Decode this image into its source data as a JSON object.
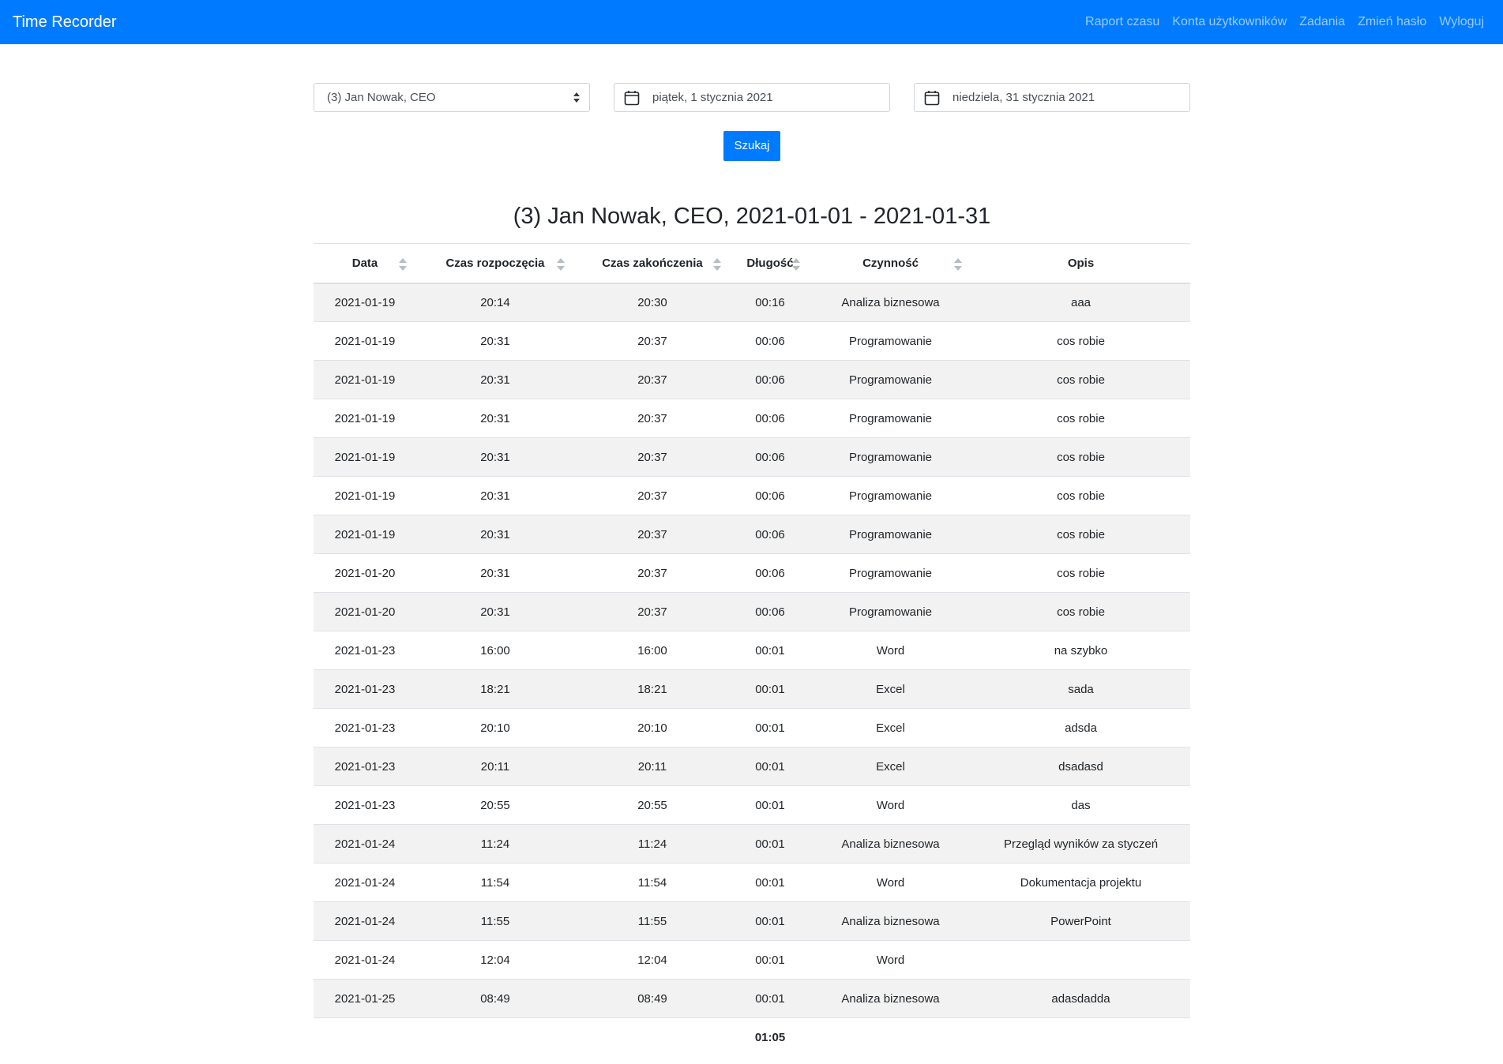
{
  "navbar": {
    "brand": "Time Recorder",
    "links": [
      "Raport czasu",
      "Konta użytkowników",
      "Zadania",
      "Zmień hasło",
      "Wyloguj"
    ]
  },
  "filters": {
    "user": "(3) Jan Nowak, CEO",
    "date_from": "piątek, 1 stycznia 2021",
    "date_to": "niedziela, 31 stycznia 2021",
    "search_label": "Szukaj"
  },
  "report": {
    "title": "(3) Jan Nowak, CEO, 2021-01-01 - 2021-01-31",
    "columns": [
      "Data",
      "Czas rozpoczęcia",
      "Czas zakończenia",
      "Długość",
      "Czynność",
      "Opis"
    ],
    "rows": [
      [
        "2021-01-19",
        "20:14",
        "20:30",
        "00:16",
        "Analiza biznesowa",
        "aaa"
      ],
      [
        "2021-01-19",
        "20:31",
        "20:37",
        "00:06",
        "Programowanie",
        "cos robie"
      ],
      [
        "2021-01-19",
        "20:31",
        "20:37",
        "00:06",
        "Programowanie",
        "cos robie"
      ],
      [
        "2021-01-19",
        "20:31",
        "20:37",
        "00:06",
        "Programowanie",
        "cos robie"
      ],
      [
        "2021-01-19",
        "20:31",
        "20:37",
        "00:06",
        "Programowanie",
        "cos robie"
      ],
      [
        "2021-01-19",
        "20:31",
        "20:37",
        "00:06",
        "Programowanie",
        "cos robie"
      ],
      [
        "2021-01-19",
        "20:31",
        "20:37",
        "00:06",
        "Programowanie",
        "cos robie"
      ],
      [
        "2021-01-20",
        "20:31",
        "20:37",
        "00:06",
        "Programowanie",
        "cos robie"
      ],
      [
        "2021-01-20",
        "20:31",
        "20:37",
        "00:06",
        "Programowanie",
        "cos robie"
      ],
      [
        "2021-01-23",
        "16:00",
        "16:00",
        "00:01",
        "Word",
        "na szybko"
      ],
      [
        "2021-01-23",
        "18:21",
        "18:21",
        "00:01",
        "Excel",
        "sada"
      ],
      [
        "2021-01-23",
        "20:10",
        "20:10",
        "00:01",
        "Excel",
        "adsda"
      ],
      [
        "2021-01-23",
        "20:11",
        "20:11",
        "00:01",
        "Excel",
        "dsadasd"
      ],
      [
        "2021-01-23",
        "20:55",
        "20:55",
        "00:01",
        "Word",
        "das"
      ],
      [
        "2021-01-24",
        "11:24",
        "11:24",
        "00:01",
        "Analiza biznesowa",
        "Przegląd wyników za styczeń"
      ],
      [
        "2021-01-24",
        "11:54",
        "11:54",
        "00:01",
        "Word",
        "Dokumentacja projektu"
      ],
      [
        "2021-01-24",
        "11:55",
        "11:55",
        "00:01",
        "Analiza biznesowa",
        "PowerPoint"
      ],
      [
        "2021-01-24",
        "12:04",
        "12:04",
        "00:01",
        "Word",
        ""
      ],
      [
        "2021-01-25",
        "08:49",
        "08:49",
        "00:01",
        "Analiza biznesowa",
        "adasdadda"
      ]
    ],
    "total": "01:05"
  }
}
